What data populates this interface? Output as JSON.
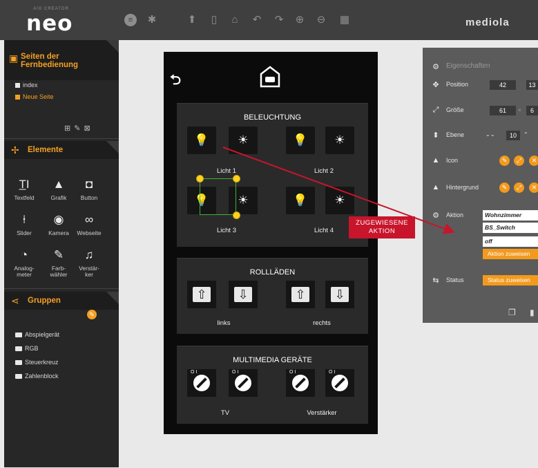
{
  "header": {
    "logo_small": "AIO CREATOR",
    "logo_big": "neo",
    "brand": "mediola",
    "tools": [
      "menu-icon",
      "settings-icon",
      "upload-icon",
      "phone-icon",
      "home-icon",
      "undo-icon",
      "redo-icon",
      "zoom-in-icon",
      "zoom-out-icon",
      "grid-icon"
    ]
  },
  "sidebar": {
    "pages": {
      "title": "Seiten der Fernbedienung",
      "items": [
        {
          "label": "index",
          "active": false
        },
        {
          "label": "Neue Seite",
          "active": true
        }
      ]
    },
    "elements": {
      "title": "Elemente",
      "items": [
        {
          "label": "Textfeld",
          "icon": "text-field-icon"
        },
        {
          "label": "Grafik",
          "icon": "image-icon"
        },
        {
          "label": "Button",
          "icon": "button-icon"
        },
        {
          "label": "Slider",
          "icon": "slider-icon"
        },
        {
          "label": "Kamera",
          "icon": "camera-icon"
        },
        {
          "label": "Webseite",
          "icon": "link-icon"
        },
        {
          "label": "Analog-\nmeter",
          "icon": "gauge-icon"
        },
        {
          "label": "Farb-\nwähler",
          "icon": "color-picker-icon"
        },
        {
          "label": "Verstär-\nker",
          "icon": "music-note-icon"
        }
      ]
    },
    "groups": {
      "title": "Gruppen",
      "items": [
        "Abspielgerät",
        "RGB",
        "Steuerkreuz",
        "Zahlenblock"
      ]
    }
  },
  "phone": {
    "groups": [
      {
        "title": "BELEUCHTUNG",
        "devices": [
          "Licht 1",
          "Licht 2",
          "Licht 3",
          "Licht 4"
        ]
      },
      {
        "title": "ROLLLÄDEN",
        "devices": [
          "links",
          "rechts"
        ]
      },
      {
        "title": "MULTIMEDIA GERÄTE",
        "devices": [
          "TV",
          "Verstärker"
        ]
      }
    ],
    "knob_label": "O   I"
  },
  "annotation": {
    "line1": "ZUGEWIESENE",
    "line2": "AKTION",
    "color": "#c8152b"
  },
  "properties": {
    "title": "Eigenschaften",
    "position": {
      "label": "Position",
      "x": "42",
      "y": "13"
    },
    "size": {
      "label": "Größe",
      "w": "61",
      "h": "6"
    },
    "level": {
      "label": "Ebene",
      "value": "10"
    },
    "icon_label": "Icon",
    "background_label": "Hintergrund",
    "action": {
      "label": "Aktion",
      "room": "Wohnzimmer",
      "device": "BS_Switch",
      "command": "off",
      "assign_button": "Aktion zuweisen"
    },
    "status": {
      "label": "Status",
      "assign_button": "Status zuweisen"
    }
  },
  "colors": {
    "accent": "#f5a023",
    "selection": "#3fb43a",
    "handle": "#ffd21d"
  }
}
